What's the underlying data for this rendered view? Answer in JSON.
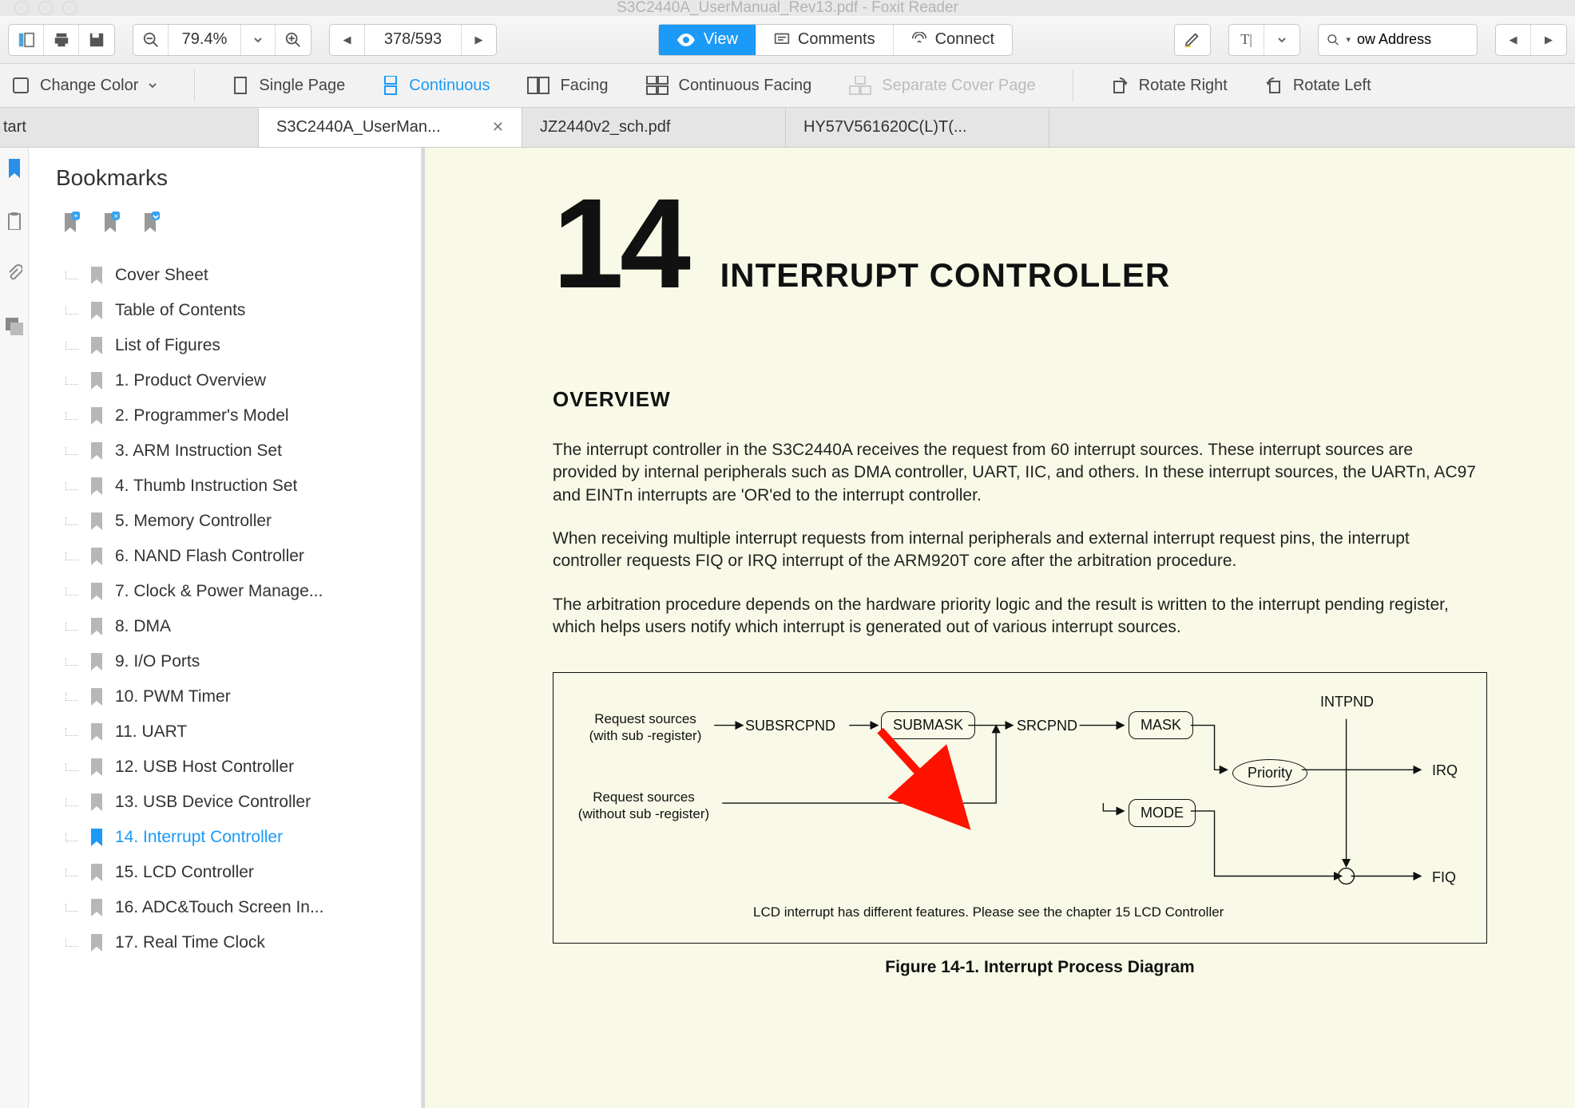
{
  "window": {
    "title": "S3C2440A_UserManual_Rev13.pdf - Foxit Reader"
  },
  "toolbar1": {
    "zoom": "79.4%",
    "page": "378/593",
    "view": "View",
    "comments": "Comments",
    "connect": "Connect",
    "search_placeholder": "ow Address"
  },
  "toolbar2": {
    "change_color": "Change Color",
    "single_page": "Single Page",
    "continuous": "Continuous",
    "facing": "Facing",
    "continuous_facing": "Continuous Facing",
    "separate_cover": "Separate Cover Page",
    "rotate_right": "Rotate Right",
    "rotate_left": "Rotate Left"
  },
  "tabs": [
    {
      "label": "tart"
    },
    {
      "label": "S3C2440A_UserMan...",
      "active": true,
      "closable": true
    },
    {
      "label": "JZ2440v2_sch.pdf"
    },
    {
      "label": "HY57V561620C(L)T(..."
    }
  ],
  "bookmarks": {
    "title": "Bookmarks",
    "items": [
      "Cover Sheet",
      "Table of Contents",
      "List of Figures",
      "1. Product Overview",
      "2. Programmer's Model",
      "3. ARM Instruction Set",
      "4. Thumb Instruction Set",
      "5. Memory Controller",
      "6. NAND Flash Controller",
      "7. Clock & Power Manage...",
      "8. DMA",
      "9. I/O Ports",
      "10. PWM Timer",
      "11. UART",
      "12. USB Host Controller",
      "13. USB Device Controller",
      "14. Interrupt Controller",
      "15. LCD Controller",
      "16. ADC&Touch Screen In...",
      "17. Real Time Clock"
    ],
    "selected_index": 16
  },
  "page": {
    "chapter_number": "14",
    "chapter_title": "INTERRUPT CONTROLLER",
    "overview_heading": "OVERVIEW",
    "para1": "The interrupt controller in the S3C2440A receives the request from 60 interrupt sources. These interrupt sources are provided by internal peripherals such as DMA controller, UART, IIC, and others. In these interrupt sources, the UARTn, AC97 and EINTn interrupts are 'OR'ed to the interrupt controller.",
    "para2": "When receiving multiple interrupt requests from internal peripherals and external interrupt request pins, the interrupt controller requests FIQ or IRQ interrupt of the ARM920T core after the arbitration procedure.",
    "para3": "The arbitration procedure depends on the hardware priority logic and the result is written to the interrupt pending register, which helps users notify which interrupt is generated out of various interrupt sources.",
    "diagram": {
      "req_with": "Request sources\n(with sub -register)",
      "req_without": "Request sources\n(without sub -register)",
      "subsrcpnd": "SUBSRCPND",
      "submask": "SUBMASK",
      "srcpnd": "SRCPND",
      "mask": "MASK",
      "mode": "MODE",
      "priority": "Priority",
      "intpnd": "INTPND",
      "irq": "IRQ",
      "fiq": "FIQ",
      "footnote": "LCD interrupt has different features. Please see the chapter 15 LCD Controller"
    },
    "figure_caption": "Figure 14-1. Interrupt Process Diagram"
  }
}
